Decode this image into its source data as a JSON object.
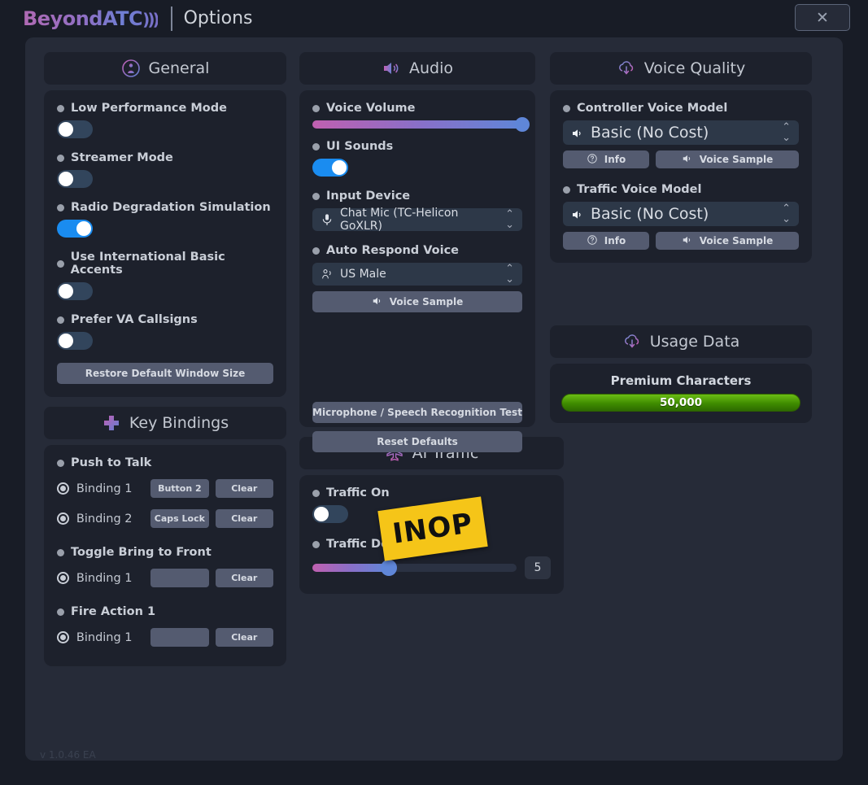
{
  "app": {
    "brand": "BeyondATC",
    "brand_waves": ")))",
    "window_title": "Options",
    "close_label": "✕",
    "version": "v 1.0.46 EA"
  },
  "general": {
    "header": "General",
    "header_icon": "person-circle-icon",
    "toggles": [
      {
        "label": "Low Performance Mode",
        "state": "off"
      },
      {
        "label": "Streamer Mode",
        "state": "off"
      },
      {
        "label": "Radio Degradation Simulation",
        "state": "on"
      },
      {
        "label": "Use International Basic Accents",
        "state": "off"
      },
      {
        "label": "Prefer VA Callsigns",
        "state": "off"
      }
    ],
    "restore_button": "Restore Default Window Size"
  },
  "key_bindings": {
    "header": "Key Bindings",
    "header_icon": "dpad-icon",
    "groups": [
      {
        "title": "Push to Talk",
        "rows": [
          {
            "name": "Binding 1",
            "key": "Button 2",
            "clear": "Clear"
          },
          {
            "name": "Binding 2",
            "key": "Caps Lock",
            "clear": "Clear"
          }
        ]
      },
      {
        "title": "Toggle Bring to Front",
        "rows": [
          {
            "name": "Binding 1",
            "key": "",
            "clear": "Clear"
          }
        ]
      },
      {
        "title": "Fire Action 1",
        "rows": [
          {
            "name": "Binding 1",
            "key": "",
            "clear": "Clear"
          }
        ]
      }
    ]
  },
  "audio": {
    "header": "Audio",
    "header_icon": "speaker-icon",
    "voice_volume": {
      "label": "Voice Volume",
      "percent": 100
    },
    "ui_sounds": {
      "label": "UI Sounds",
      "state": "on"
    },
    "input_device": {
      "label": "Input Device",
      "value": "Chat Mic (TC-Helicon GoXLR)",
      "icon": "microphone-icon"
    },
    "auto_respond_voice": {
      "label": "Auto Respond Voice",
      "value": "US Male",
      "icon": "voice-person-icon"
    },
    "voice_sample_button": "Voice Sample",
    "mic_test_button": "Microphone / Speech Recognition Test",
    "reset_button": "Reset Defaults"
  },
  "ai_traffic": {
    "header": "AI Traffic",
    "header_icon": "airplane-icon",
    "traffic_on": {
      "label": "Traffic On",
      "state": "off"
    },
    "traffic_density": {
      "label": "Traffic Density",
      "value": 5,
      "percent": 37
    },
    "overlay_badge": "INOP"
  },
  "voice_quality": {
    "header": "Voice Quality",
    "header_icon": "cloud-download-icon",
    "models": [
      {
        "label": "Controller Voice Model",
        "value": "Basic (No Cost)",
        "info_button": "Info",
        "sample_button": "Voice Sample"
      },
      {
        "label": "Traffic Voice Model",
        "value": "Basic (No Cost)",
        "info_button": "Info",
        "sample_button": "Voice Sample"
      }
    ]
  },
  "usage_data": {
    "header": "Usage Data",
    "header_icon": "cloud-download-icon",
    "title": "Premium Characters",
    "value": "50,000",
    "bar_percent": 100,
    "bar_color": "#4f9c00"
  }
}
